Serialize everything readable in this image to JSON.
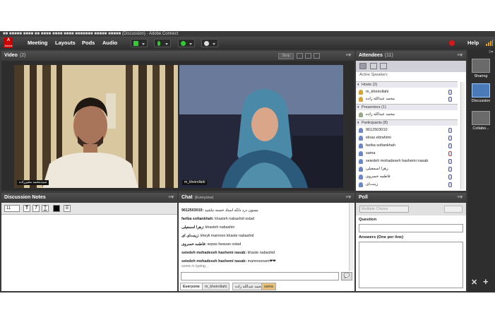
{
  "window": {
    "title": "■■ ■■■■■ ■■■■ ■■ ■■■■ ■■■■ ■■■■ ■■■■■■■ ■■■■■ ■■■■■ (Discussion) - Adobe Connect"
  },
  "menubar": {
    "logo": "Adobe",
    "items": [
      "Meeting",
      "Layouts",
      "Pods",
      "Audio"
    ],
    "help": "Help"
  },
  "video": {
    "title": "Video",
    "count": "(2)",
    "stop_label": "Stop",
    "user1": "سیدمحمد معیرزاده",
    "user2": "m_kheirollahi"
  },
  "attendees": {
    "title": "Attendees",
    "count": "(11)",
    "active_speakers": "Active Speakers",
    "hosts_header": "Hosts (2)",
    "hosts": [
      "m_kheirollahi",
      "محمد عبدالله زاده"
    ],
    "presenters_header": "Presenters (1)",
    "presenters": [
      "محمد عبدالله زاده"
    ],
    "participants_header": "Participants (8)",
    "participants": [
      "9612503010",
      "elnaz.ebrahimi",
      "fariba soltankhah",
      "sama",
      "seiedeh mohadeseh hashemi nasab",
      "زهرا اسمعیلی",
      "فاطمه خسروی",
      "زینت‌ای"
    ]
  },
  "right_panel": {
    "layouts": [
      "Sharing",
      "Discussion",
      "Collabo..."
    ]
  },
  "notes": {
    "title": "Discussion Notes",
    "font_size": "11"
  },
  "chat": {
    "title": "Chat",
    "scope": "(Everyone)",
    "messages": [
      {
        "sender": "9612503010:",
        "text": "ممنون درد دلکه استاد خسته نباشید"
      },
      {
        "sender": "fariba soltankhah:",
        "text": "khasteh nabashid ostad"
      },
      {
        "sender": "زهرا اسمعیلی:",
        "text": "khasteh nabashin"
      },
      {
        "sender": "زینت‌ای ای:",
        "text": "kheyli mamnon khaste nabashid"
      },
      {
        "sender": "فاطمه خسروی:",
        "text": "sepas faravan ostad"
      },
      {
        "sender": "seiedeh mohadeseh hashemi nasab:",
        "text": "khaste nabashid"
      },
      {
        "sender": "seiedeh mohadeseh hashemi nasab:",
        "text": "mamnoonam❤❤"
      }
    ],
    "typing": "some is typing...",
    "tabs": [
      "Everyone",
      "m_kheirollahi",
      "محمد عبدالله زاده",
      "sama"
    ]
  },
  "poll": {
    "title": "Poll",
    "type": "Multiple Choice",
    "question_label": "Question",
    "answers_label": "Answers (One per line)"
  },
  "colors": {
    "accent": "#e8a000",
    "record": "#d81818",
    "host_icon": "#d7a23a",
    "user_icon": "#6c86c8"
  }
}
